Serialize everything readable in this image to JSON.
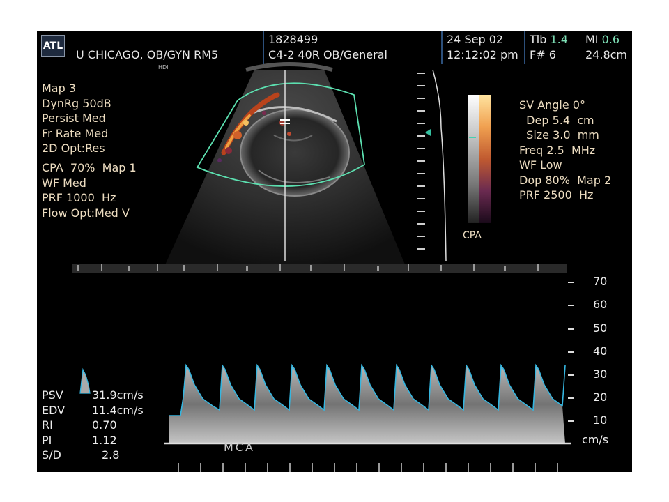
{
  "header": {
    "logo": "ATL",
    "site": "U CHICAGO, OB/GYN RM5",
    "patient_id": "1828499",
    "probe": "C4-2 40R OB/General",
    "date": "24 Sep 02",
    "time": "12:12:02 pm",
    "tib_label": "Tlb",
    "tib_value": "1.4",
    "mi_label": "MI",
    "mi_value": "0.6",
    "frame": "F# 6",
    "depth": "24.8cm",
    "hdi": "HDI"
  },
  "left_params": {
    "lines_2d": [
      "Map 3",
      "DynRg 50dB",
      "Persist Med",
      "Fr Rate Med",
      "2D Opt:Res"
    ],
    "lines_cpa": [
      "CPA  70%  Map 1",
      "WF Med",
      "PRF 1000  Hz",
      "Flow Opt:Med V"
    ]
  },
  "right_params": {
    "lines": [
      "SV Angle 0°",
      "  Dep 5.4  cm",
      "  Size 3.0  mm",
      "Freq 2.5  MHz",
      "WF Low",
      "Dop 80%  Map 2",
      "PRF 2500  Hz"
    ]
  },
  "color_bar_label": "CPA",
  "spectral": {
    "scale": [
      "70",
      "60",
      "50",
      "40",
      "30",
      "20",
      "10"
    ],
    "unit": "cm/s",
    "vessel": "MCA",
    "colors": {
      "envelope": "#35b6e0",
      "accent": "#5fd7f0"
    }
  },
  "measurements": [
    {
      "label": "PSV",
      "value": "31.9cm/s"
    },
    {
      "label": "EDV",
      "value": "11.4cm/s"
    },
    {
      "label": "RI",
      "value": "0.70"
    },
    {
      "label": "PI",
      "value": "1.12"
    },
    {
      "label": "S/D",
      "value": "2.8"
    }
  ]
}
